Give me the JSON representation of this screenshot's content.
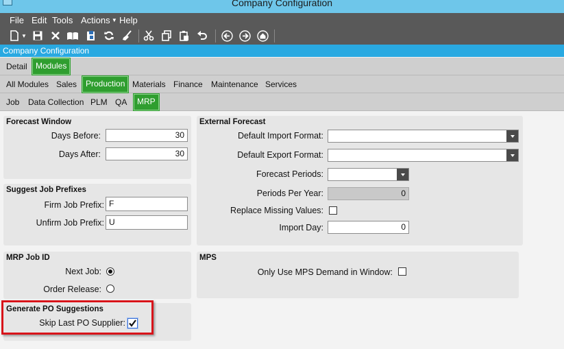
{
  "window": {
    "title": "Company Configuration"
  },
  "menu": {
    "file": "File",
    "edit": "Edit",
    "tools": "Tools",
    "actions": "Actions",
    "help": "Help"
  },
  "toolbar": {
    "icons": [
      "new-icon",
      "save-icon",
      "delete-icon",
      "open-book-icon",
      "attach-icon",
      "refresh-icon",
      "clear-icon",
      "cut-icon",
      "copy-icon",
      "paste-icon",
      "undo-icon",
      "back-icon",
      "forward-icon",
      "home-icon"
    ]
  },
  "form": {
    "title": "Company Configuration"
  },
  "tabs": {
    "level1": [
      "Detail",
      "Modules"
    ],
    "level2": [
      "All Modules",
      "Sales",
      "Production",
      "Materials",
      "Finance",
      "Maintenance",
      "Services"
    ],
    "level3": [
      "Job",
      "Data Collection",
      "PLM",
      "QA",
      "MRP"
    ]
  },
  "forecast_window": {
    "title": "Forecast Window",
    "days_before_label": "Days Before:",
    "days_before": "30",
    "days_after_label": "Days After:",
    "days_after": "30"
  },
  "external_forecast": {
    "title": "External Forecast",
    "import_format_label": "Default Import Format:",
    "import_format": "",
    "export_format_label": "Default Export Format:",
    "export_format": "",
    "periods_label": "Forecast Periods:",
    "periods": "",
    "per_year_label": "Periods Per Year:",
    "per_year": "0",
    "replace_missing_label": "Replace Missing Values:",
    "replace_missing": false,
    "import_day_label": "Import Day:",
    "import_day": "0"
  },
  "job_prefixes": {
    "title": "Suggest Job Prefixes",
    "firm_label": "Firm Job Prefix:",
    "firm": "F",
    "unfirm_label": "Unfirm Job Prefix:",
    "unfirm": "U"
  },
  "mrp_job_id": {
    "title": "MRP Job ID",
    "next_job_label": "Next Job:",
    "order_release_label": "Order Release:",
    "selected": "Next Job"
  },
  "mps": {
    "title": "MPS",
    "only_use_label": "Only Use MPS Demand in Window:",
    "only_use": false
  },
  "po_suggestions": {
    "title": "Generate PO Suggestions",
    "skip_last_label": "Skip Last PO Supplier:",
    "skip_last": true
  },
  "colors": {
    "active_tab": "#2f9e2f",
    "form_bar": "#29a9e1",
    "title_bar": "#6ec6ea",
    "highlight": "#d8141a",
    "menu_bg": "#595959"
  }
}
